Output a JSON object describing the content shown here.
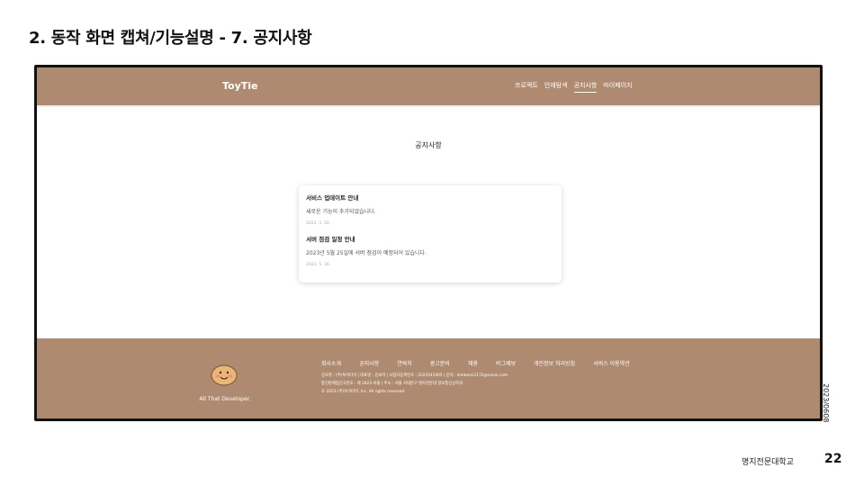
{
  "slide": {
    "title": "2. 동작 화면 캡쳐/기능설명 - 7. 공지사항",
    "side_date": "2023/0608",
    "school": "명지전문대학교",
    "page_number": "22"
  },
  "site": {
    "logo": "ToyTie",
    "nav": [
      "프로젝트",
      "인재탐색",
      "공지사항",
      "마이페이지"
    ],
    "nav_active": "공지사항",
    "page_heading": "공지사항",
    "notices": [
      {
        "title": "서비스 업데이트 안내",
        "body": "새로운 기능이 추가되었습니다.",
        "date": "2023. 5. 20."
      },
      {
        "title": "서버 점검 일정 안내",
        "body": "2023년 5월 25일에 서버 점검이 예정되어 있습니다.",
        "date": "2023. 5. 16."
      }
    ],
    "footer": {
      "tagline": "All That Developer.",
      "links": [
        "회사소개",
        "공지사항",
        "연락처",
        "광고문의",
        "채용",
        "버그제보",
        "개인정보 처리방침",
        "서비스 이용약관"
      ],
      "info_line1": "상호명 : (주)투이타이 | 대표명 : 김보미 | 사업자등록번호 : 2023541005 | 문의 : kimbomi2172@naver.com",
      "info_line2": "통신판매업신고번호 : 제 2023-서울 | 주소 : 서울 서대문구 명지전문대 정보통신공학과",
      "info_line3": "© 2023 (주)토이타이. Inc. All rights reserved."
    }
  },
  "colors": {
    "brand": "#ae8b70",
    "frame": "#111111"
  },
  "icons": {
    "mascot": "smiling-potato-mascot"
  }
}
